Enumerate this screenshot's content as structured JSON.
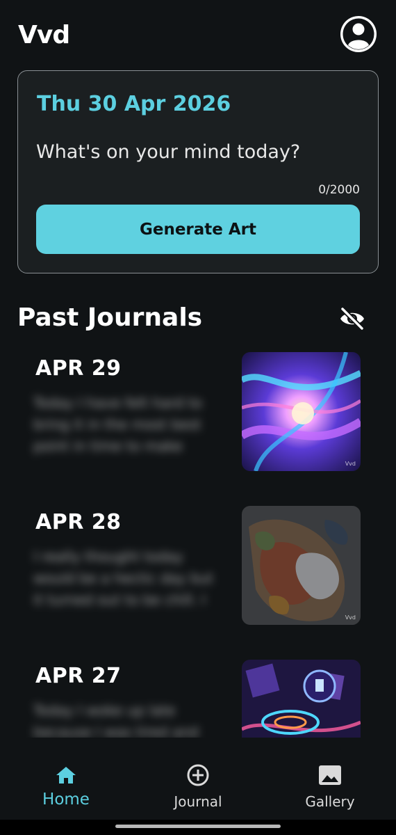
{
  "app": {
    "title": "Vvd"
  },
  "header": {
    "profile_icon": "account-circle-icon"
  },
  "entry": {
    "date": "Thu 30 Apr 2026",
    "placeholder": "What's on your mind today?",
    "char_count": "0/2000",
    "generate_label": "Generate Art"
  },
  "past": {
    "title": "Past Journals",
    "visibility_icon": "eye-off-icon",
    "items": [
      {
        "date": "APR 29",
        "preview": "Today I have felt hard to bring it in the most best point in time to make"
      },
      {
        "date": "APR 28",
        "preview": "I really thought today would be a hectic day but it turned out to be chill. I"
      },
      {
        "date": "APR 27",
        "preview": "Today I woke up late because I was tired and"
      }
    ],
    "thumb_signature": "Vvd"
  },
  "nav": {
    "items": [
      {
        "label": "Home",
        "icon": "home-icon",
        "active": true
      },
      {
        "label": "Journal",
        "icon": "add-circle-icon",
        "active": false
      },
      {
        "label": "Gallery",
        "icon": "image-icon",
        "active": false
      }
    ]
  },
  "colors": {
    "accent": "#5ccfe0",
    "background": "#101315",
    "card": "#1b1f21"
  }
}
